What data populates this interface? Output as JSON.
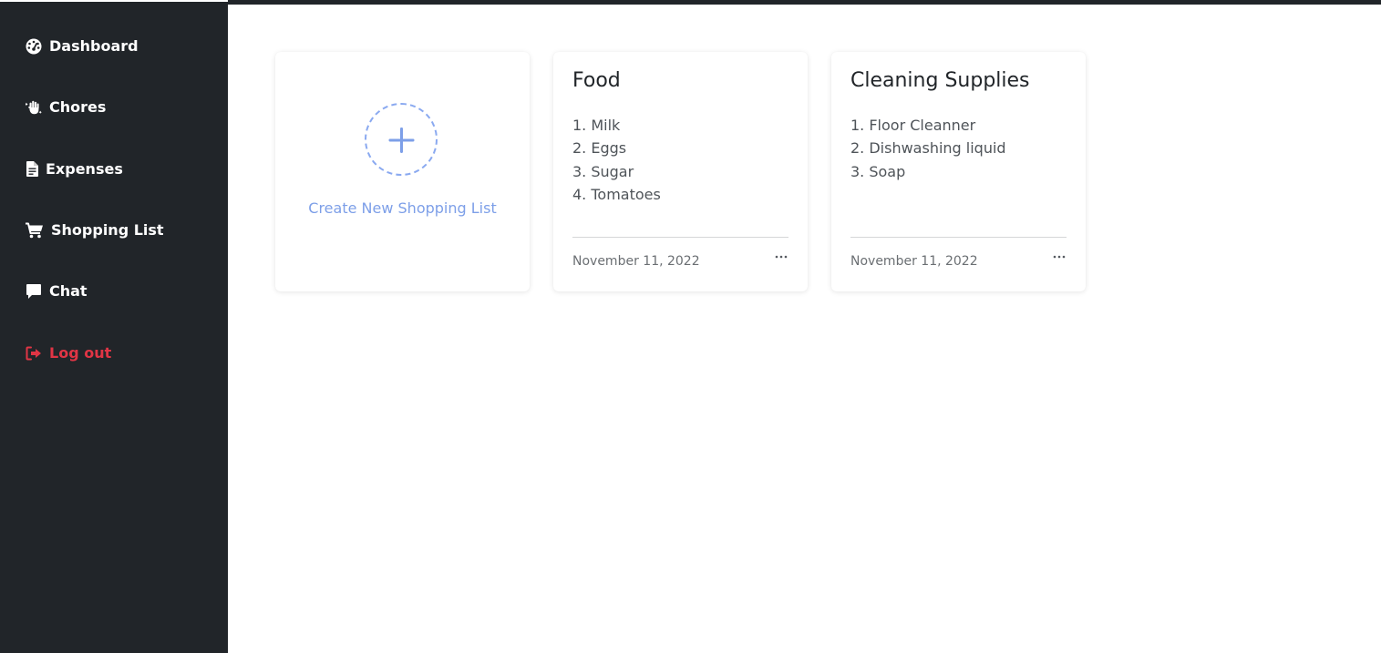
{
  "nav": {
    "items": [
      {
        "label": "Dashboard",
        "icon": "dashboard-icon"
      },
      {
        "label": "Chores",
        "icon": "hand-sparkles-icon"
      },
      {
        "label": "Expenses",
        "icon": "receipt-icon"
      },
      {
        "label": "Shopping List",
        "icon": "cart-icon"
      },
      {
        "label": "Chat",
        "icon": "chat-bubble-icon"
      }
    ],
    "logout": {
      "label": "Log out",
      "icon": "logout-icon",
      "color": "#e03545"
    }
  },
  "create_card": {
    "label": "Create New Shopping List",
    "icon": "plus-icon",
    "accent": "#7d9fe8"
  },
  "lists": [
    {
      "title": "Food",
      "items": [
        "1. Milk",
        "2. Eggs",
        "3. Sugar",
        "4. Tomatoes"
      ],
      "date": "November 11, 2022",
      "menu_icon": "ellipsis-icon"
    },
    {
      "title": "Cleaning Supplies",
      "items": [
        "1. Floor Cleanner",
        "2. Dishwashing liquid",
        "3. Soap"
      ],
      "date": "November 11, 2022",
      "menu_icon": "ellipsis-icon"
    }
  ],
  "colors": {
    "sidebar_bg": "#212529",
    "text_dark": "#212529"
  }
}
